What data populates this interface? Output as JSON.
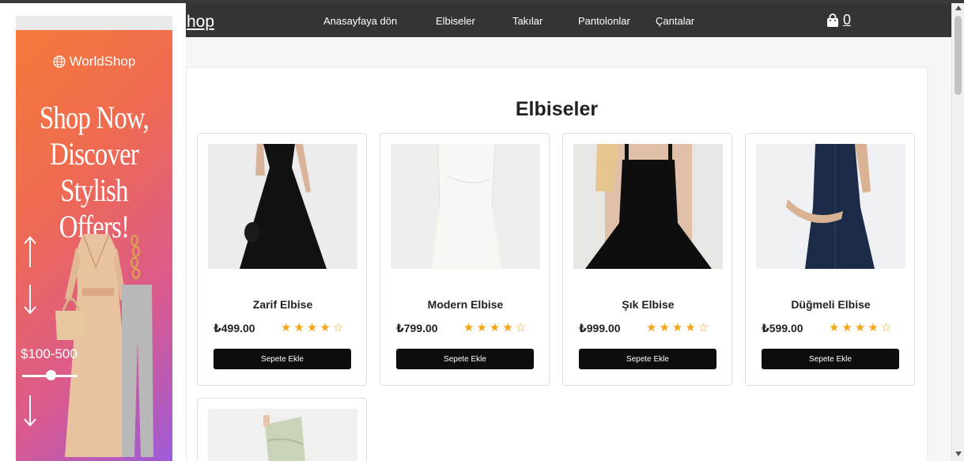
{
  "header": {
    "brand": "hop",
    "nav": [
      "Anasayfaya dön",
      "Elbiseler",
      "Takılar",
      "Pantolonlar",
      "Çantalar"
    ],
    "cart_count": "0"
  },
  "ad": {
    "logo": "WorldShop",
    "headline": [
      "Shop Now,",
      "Discover Stylish",
      "Offers!"
    ],
    "price_range": "$100-500"
  },
  "main": {
    "title": "Elbiseler",
    "products": [
      {
        "name": "Zarif Elbise",
        "price": "₺499.00",
        "rating": 4,
        "stars": "★★★★☆",
        "button": "Sepete Ekle"
      },
      {
        "name": "Modern Elbise",
        "price": "₺799.00",
        "rating": 4,
        "stars": "★★★★☆",
        "button": "Sepete Ekle"
      },
      {
        "name": "Şık Elbise",
        "price": "₺999.00",
        "rating": 4,
        "stars": "★★★★☆",
        "button": "Sepete Ekle"
      },
      {
        "name": "Düğmeli Elbise",
        "price": "₺599.00",
        "rating": 4,
        "stars": "★★★★☆",
        "button": "Sepete Ekle"
      }
    ]
  },
  "colors": {
    "navbar": "#343434",
    "button": "#0d0d0d",
    "star": "#f2a516",
    "ad_gradient_start": "#f57a3a",
    "ad_gradient_end": "#9d5bd8"
  },
  "icons": {
    "cart": "shopping-bag-icon",
    "ad_logo": "globe-icon",
    "star": "star-icon"
  }
}
